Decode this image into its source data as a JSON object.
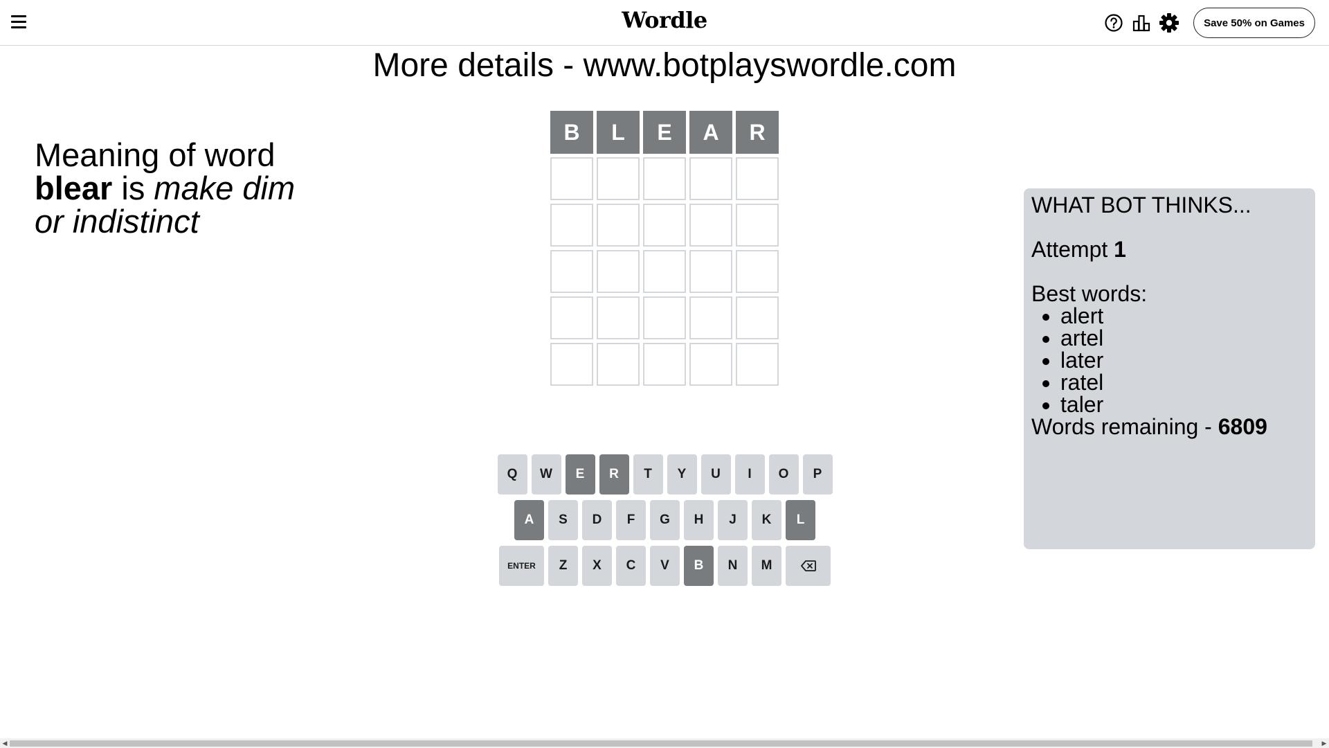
{
  "header": {
    "title": "Wordle",
    "menu_icon": "hamburger-menu-icon",
    "help_icon": "help-circle-icon",
    "stats_icon": "bar-chart-icon",
    "settings_icon": "gear-icon",
    "promo_label": "Save 50% on Games"
  },
  "banner": {
    "text": "More details - www.botplayswordle.com"
  },
  "meaning": {
    "prefix": "Meaning of word",
    "word": "blear",
    "connector": "is",
    "definition": "make dim or indistinct"
  },
  "board": {
    "rows": [
      [
        {
          "letter": "B",
          "state": "absent"
        },
        {
          "letter": "L",
          "state": "absent"
        },
        {
          "letter": "E",
          "state": "absent"
        },
        {
          "letter": "A",
          "state": "absent"
        },
        {
          "letter": "R",
          "state": "absent"
        }
      ],
      [
        {
          "letter": "",
          "state": "empty"
        },
        {
          "letter": "",
          "state": "empty"
        },
        {
          "letter": "",
          "state": "empty"
        },
        {
          "letter": "",
          "state": "empty"
        },
        {
          "letter": "",
          "state": "empty"
        }
      ],
      [
        {
          "letter": "",
          "state": "empty"
        },
        {
          "letter": "",
          "state": "empty"
        },
        {
          "letter": "",
          "state": "empty"
        },
        {
          "letter": "",
          "state": "empty"
        },
        {
          "letter": "",
          "state": "empty"
        }
      ],
      [
        {
          "letter": "",
          "state": "empty"
        },
        {
          "letter": "",
          "state": "empty"
        },
        {
          "letter": "",
          "state": "empty"
        },
        {
          "letter": "",
          "state": "empty"
        },
        {
          "letter": "",
          "state": "empty"
        }
      ],
      [
        {
          "letter": "",
          "state": "empty"
        },
        {
          "letter": "",
          "state": "empty"
        },
        {
          "letter": "",
          "state": "empty"
        },
        {
          "letter": "",
          "state": "empty"
        },
        {
          "letter": "",
          "state": "empty"
        }
      ],
      [
        {
          "letter": "",
          "state": "empty"
        },
        {
          "letter": "",
          "state": "empty"
        },
        {
          "letter": "",
          "state": "empty"
        },
        {
          "letter": "",
          "state": "empty"
        },
        {
          "letter": "",
          "state": "empty"
        }
      ]
    ]
  },
  "keyboard": {
    "rows": [
      [
        {
          "key": "Q"
        },
        {
          "key": "W"
        },
        {
          "key": "E",
          "state": "absent"
        },
        {
          "key": "R",
          "state": "absent"
        },
        {
          "key": "T"
        },
        {
          "key": "Y"
        },
        {
          "key": "U"
        },
        {
          "key": "I"
        },
        {
          "key": "O"
        },
        {
          "key": "P"
        }
      ],
      [
        {
          "key": "A",
          "state": "absent"
        },
        {
          "key": "S"
        },
        {
          "key": "D"
        },
        {
          "key": "F"
        },
        {
          "key": "G"
        },
        {
          "key": "H"
        },
        {
          "key": "J"
        },
        {
          "key": "K"
        },
        {
          "key": "L",
          "state": "absent"
        }
      ],
      [
        {
          "key": "ENTER",
          "wide": true
        },
        {
          "key": "Z"
        },
        {
          "key": "X"
        },
        {
          "key": "C"
        },
        {
          "key": "V"
        },
        {
          "key": "B",
          "state": "absent"
        },
        {
          "key": "N"
        },
        {
          "key": "M"
        },
        {
          "key": "",
          "wide": true,
          "icon": "backspace-icon"
        }
      ]
    ]
  },
  "bot_panel": {
    "heading": "WHAT BOT THINKS...",
    "attempt_label": "Attempt",
    "attempt_value": "1",
    "best_label": "Best words:",
    "best_words": [
      "alert",
      "artel",
      "later",
      "ratel",
      "taler"
    ],
    "remaining_label": "Words remaining -",
    "remaining_value": "6809"
  },
  "colors": {
    "absent": "#787c7e",
    "key_default": "#d3d6da",
    "tile_border": "#d3d6da",
    "panel_bg": "#d3d6da"
  }
}
